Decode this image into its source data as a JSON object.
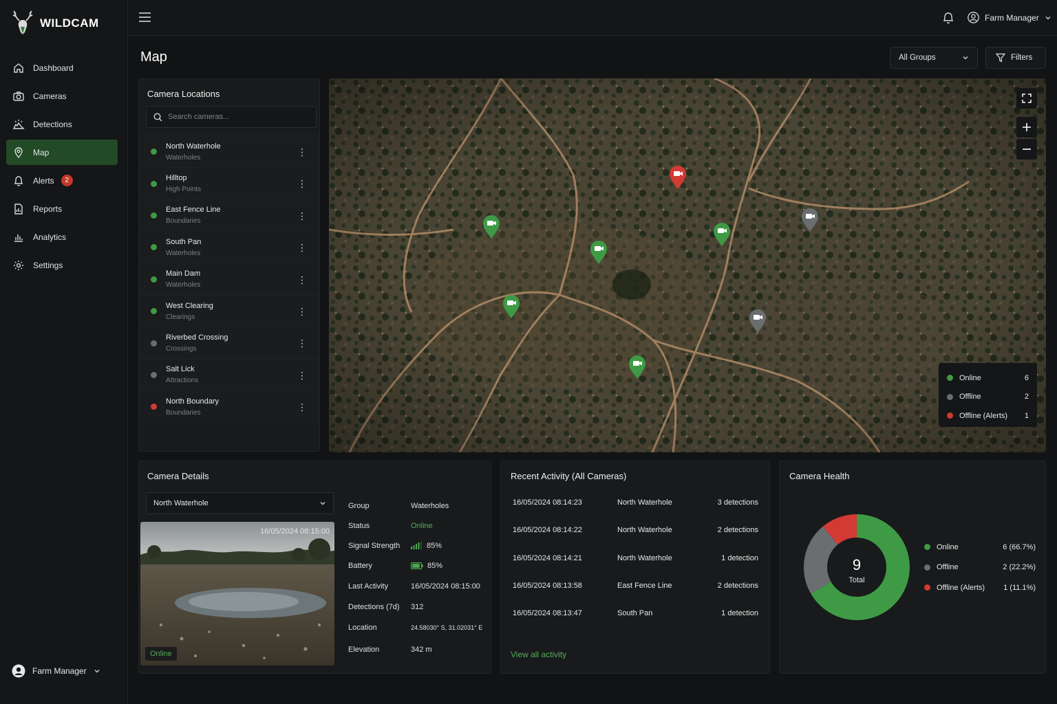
{
  "app": {
    "brand": "WILDCAM"
  },
  "colors": {
    "online": "#3f9a45",
    "offline": "#6b6e70",
    "alert": "#d23a33",
    "accent": "#234a26"
  },
  "sidebar": {
    "items": [
      {
        "label": "Dashboard",
        "icon": "home-icon"
      },
      {
        "label": "Cameras",
        "icon": "camera-icon"
      },
      {
        "label": "Detections",
        "icon": "detections-icon"
      },
      {
        "label": "Map",
        "icon": "map-pin-icon",
        "active": true
      },
      {
        "label": "Alerts",
        "icon": "bell-icon",
        "badge": "2"
      },
      {
        "label": "Reports",
        "icon": "reports-icon"
      },
      {
        "label": "Analytics",
        "icon": "analytics-icon"
      },
      {
        "label": "Settings",
        "icon": "settings-icon"
      }
    ],
    "user": "Farm Manager"
  },
  "topbar": {
    "user": "Farm Manager"
  },
  "page": {
    "title": "Map",
    "group_select": "All Groups",
    "filters_label": "Filters"
  },
  "locations": {
    "title": "Camera Locations",
    "search_placeholder": "Search cameras...",
    "cameras": [
      {
        "name": "North Waterhole",
        "group": "Waterholes",
        "status": "online"
      },
      {
        "name": "Hilltop",
        "group": "High Points",
        "status": "online"
      },
      {
        "name": "East Fence Line",
        "group": "Boundaries",
        "status": "online"
      },
      {
        "name": "South Pan",
        "group": "Waterholes",
        "status": "online"
      },
      {
        "name": "Main Dam",
        "group": "Waterholes",
        "status": "online"
      },
      {
        "name": "West Clearing",
        "group": "Clearings",
        "status": "online"
      },
      {
        "name": "Riverbed Crossing",
        "group": "Crossings",
        "status": "offline"
      },
      {
        "name": "Salt Lick",
        "group": "Attractions",
        "status": "offline"
      },
      {
        "name": "North Boundary",
        "group": "Boundaries",
        "status": "alert"
      }
    ]
  },
  "map": {
    "legend": [
      {
        "label": "Online",
        "count": "6",
        "status": "online"
      },
      {
        "label": "Offline",
        "count": "2",
        "status": "offline"
      },
      {
        "label": "Offline (Alerts)",
        "count": "1",
        "status": "alert"
      }
    ]
  },
  "details": {
    "title": "Camera Details",
    "selected": "North Waterhole",
    "photo_timestamp": "16/05/2024 08:15:00",
    "photo_status": "Online",
    "fields": [
      {
        "key": "Group",
        "value": "Waterholes"
      },
      {
        "key": "Status",
        "value": "Online"
      },
      {
        "key": "Signal Strength",
        "value": "85%"
      },
      {
        "key": "Battery",
        "value": "85%"
      },
      {
        "key": "Last Activity",
        "value": "16/05/2024 08:15:00"
      },
      {
        "key": "Detections (7d)",
        "value": "312"
      },
      {
        "key": "Location",
        "value": "24.58030° S, 31.02031° E"
      },
      {
        "key": "Elevation",
        "value": "342 m"
      }
    ]
  },
  "activity": {
    "title": "Recent Activity (All Cameras)",
    "rows": [
      {
        "time": "16/05/2024 08:14:23",
        "camera": "North Waterhole",
        "count": "3 detections"
      },
      {
        "time": "16/05/2024 08:14:22",
        "camera": "North Waterhole",
        "count": "2 detections"
      },
      {
        "time": "16/05/2024 08:14:21",
        "camera": "North Waterhole",
        "count": "1 detection"
      },
      {
        "time": "16/05/2024 08:13:58",
        "camera": "East Fence Line",
        "count": "2 detections"
      },
      {
        "time": "16/05/2024 08:13:47",
        "camera": "South Pan",
        "count": "1 detection"
      }
    ],
    "view_all": "View all activity"
  },
  "health": {
    "title": "Camera Health",
    "total": "9",
    "total_label": "Total",
    "rows": [
      {
        "label": "Online",
        "value": "6 (66.7%)",
        "status": "online",
        "count": 6
      },
      {
        "label": "Offline",
        "value": "2 (22.2%)",
        "status": "offline",
        "count": 2
      },
      {
        "label": "Offline (Alerts)",
        "value": "1 (11.1%)",
        "status": "alert",
        "count": 1
      }
    ]
  }
}
